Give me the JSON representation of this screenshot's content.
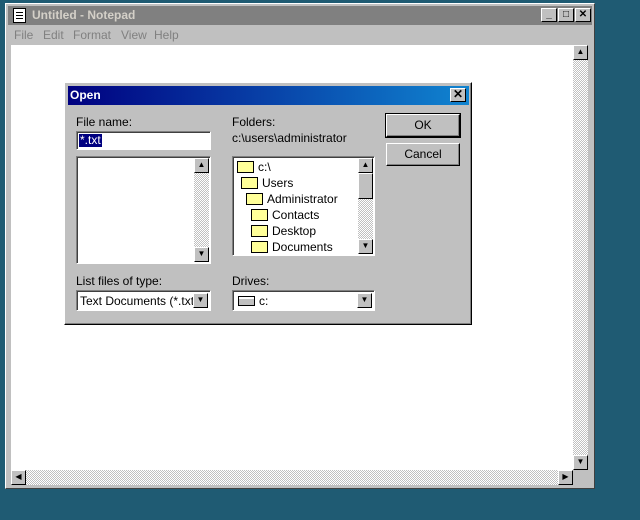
{
  "notepad": {
    "title": "Untitled - Notepad",
    "menu": [
      "File",
      "Edit",
      "Format",
      "View",
      "Help"
    ],
    "caption_buttons": {
      "minimize": "_",
      "maximize": "□",
      "close": "✕"
    }
  },
  "dialog": {
    "title": "Open",
    "close_glyph": "✕",
    "file_name_label": "File name:",
    "file_name_value": "*.txt",
    "folders_label": "Folders:",
    "current_path": "c:\\users\\administrator",
    "folders": [
      "c:\\",
      "Users",
      "Administrator",
      "Contacts",
      "Desktop",
      "Documents"
    ],
    "list_type_label": "List files of type:",
    "file_type_value": "Text Documents (*.txt)",
    "drives_label": "Drives:",
    "drive_value": "c:",
    "ok_label": "OK",
    "cancel_label": "Cancel"
  },
  "glyphs": {
    "up": "▲",
    "down": "▼",
    "left": "◀",
    "right": "▶"
  }
}
